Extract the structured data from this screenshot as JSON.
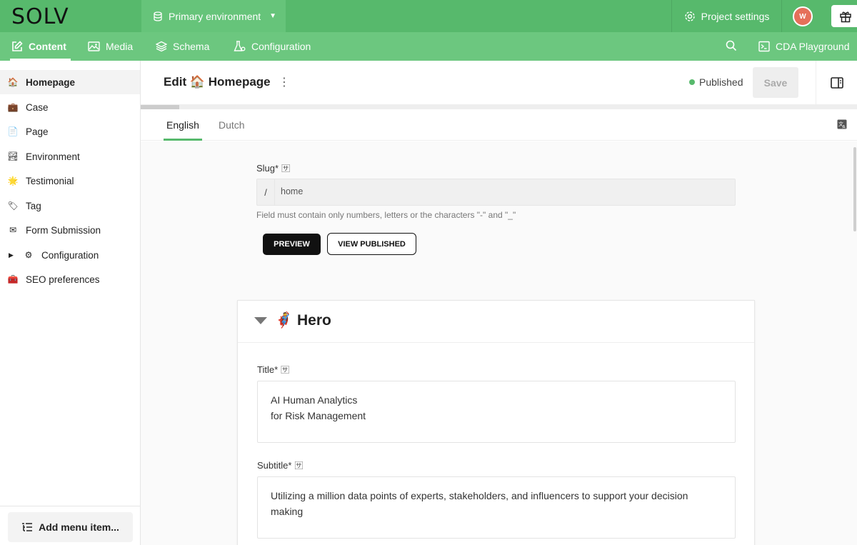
{
  "topbar": {
    "logo": "SOLV",
    "environment": "Primary environment",
    "project_settings": "Project settings",
    "avatar_initial": "W"
  },
  "nav": {
    "content": "Content",
    "media": "Media",
    "schema": "Schema",
    "configuration": "Configuration",
    "cda_playground": "CDA Playground"
  },
  "sidebar": {
    "items": [
      {
        "label": "Homepage",
        "emoji": "🏠"
      },
      {
        "label": "Case",
        "emoji": "💼"
      },
      {
        "label": "Page",
        "emoji": "📄"
      },
      {
        "label": "Environment",
        "emoji": "🏞"
      },
      {
        "label": "Testimonial",
        "emoji": "🌟"
      },
      {
        "label": "Tag",
        "emoji": "🏷"
      },
      {
        "label": "Form Submission",
        "emoji": "✉"
      },
      {
        "label": "Configuration",
        "emoji": "⚙"
      },
      {
        "label": "SEO preferences",
        "emoji": "🧰"
      }
    ],
    "add_menu_item": "Add menu item..."
  },
  "header": {
    "edit_title": "Edit 🏠 Homepage",
    "status": "Published",
    "save_label": "Save"
  },
  "tabs": [
    "English",
    "Dutch"
  ],
  "slug": {
    "label": "Slug*",
    "prefix": "/",
    "value": "home",
    "helper": "Field must contain only numbers, letters or the characters \"-\" and \"_\""
  },
  "buttons": {
    "preview": "PREVIEW",
    "view_published": "VIEW PUBLISHED"
  },
  "hero": {
    "heading": "🦸 Hero",
    "title_label": "Title*",
    "title_line1": "AI Human Analytics",
    "title_line2": "for Risk Management",
    "subtitle_label": "Subtitle*",
    "subtitle_value": "Utilizing a million data points of experts, stakeholders, and influencers to support your decision making"
  },
  "colors": {
    "topbar": "#57b96c",
    "navbar": "#6cc77f",
    "accent": "#57b96c",
    "avatar": "#e5705a"
  }
}
